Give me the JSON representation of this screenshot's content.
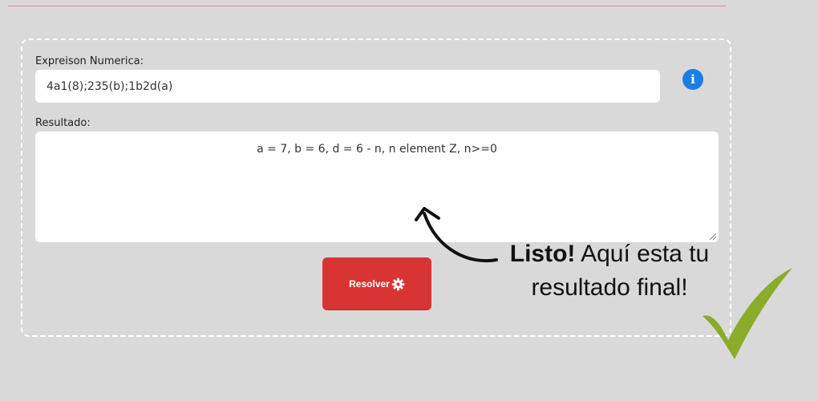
{
  "form": {
    "expression_label": "Expreison Numerica:",
    "expression_value": "4a1(8);235(b);1b2d(a)",
    "result_label": "Resultado:",
    "result_value": "a = 7, b = 6, d = 6 - n, n element Z, n>=0",
    "solve_label": "Resolver",
    "solve_icon": "gear-icon",
    "info_icon": "info-icon"
  },
  "annotation": {
    "bold": "Listo!",
    "line1": " Aquí esta tu",
    "line2": "resultado final!"
  },
  "colors": {
    "background": "#d9d9d9",
    "button": "#d93434",
    "info": "#1a7ee6",
    "check": "#8aac2a"
  }
}
